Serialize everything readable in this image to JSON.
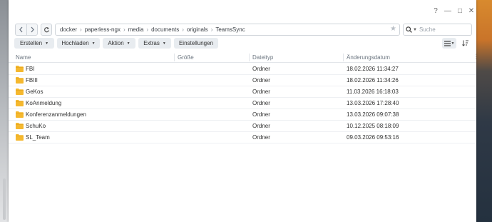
{
  "window": {
    "help_glyph": "?",
    "minimize_glyph": "—",
    "maximize_glyph": "□",
    "close_glyph": "✕"
  },
  "nav": {
    "back_icon": "chevron-left-icon",
    "forward_icon": "chevron-right-icon",
    "refresh_icon": "refresh-icon",
    "path": [
      "docker",
      "paperless-ngx",
      "media",
      "documents",
      "originals",
      "TeamsSync"
    ],
    "separator": "›",
    "favorite_icon": "star-icon",
    "search_placeholder": "Suche"
  },
  "toolbar": {
    "buttons": [
      "Erstellen",
      "Hochladen",
      "Aktion",
      "Extras",
      "Einstellungen"
    ],
    "view_list_icon": "list-view-icon",
    "sort_icon": "sort-icon"
  },
  "table": {
    "columns": [
      "Name",
      "Größe",
      "Dateityp",
      "Änderungsdatum"
    ],
    "rows": [
      {
        "name": "FBI",
        "size": "",
        "type": "Ordner",
        "modified": "18.02.2026 11:34:27"
      },
      {
        "name": "FBIII",
        "size": "",
        "type": "Ordner",
        "modified": "18.02.2026 11:34:26"
      },
      {
        "name": "GeKos",
        "size": "",
        "type": "Ordner",
        "modified": "11.03.2026 16:18:03"
      },
      {
        "name": "KoAnmeldung",
        "size": "",
        "type": "Ordner",
        "modified": "13.03.2026 17:28:40"
      },
      {
        "name": "Konferenzanmeldungen",
        "size": "",
        "type": "Ordner",
        "modified": "13.03.2026 09:07:38"
      },
      {
        "name": "SchuKo",
        "size": "",
        "type": "Ordner",
        "modified": "10.12.2025 08:18:09"
      },
      {
        "name": "SL_Team",
        "size": "",
        "type": "Ordner",
        "modified": "09.03.2026 09:53:16"
      }
    ]
  },
  "colors": {
    "folder": "#f5b82e",
    "folder_dark": "#e2a11c",
    "button_bg": "#e8ecf0",
    "header_text": "#6c7680"
  }
}
